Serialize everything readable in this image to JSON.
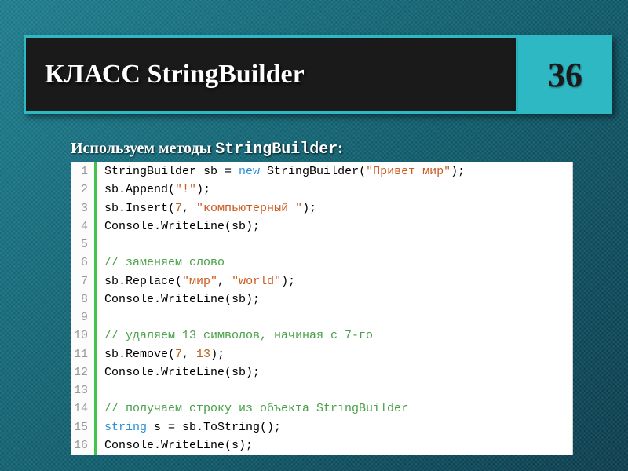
{
  "header": {
    "title": "КЛАСС StringBuilder",
    "page_number": "36"
  },
  "subtitle": {
    "prefix": "Используем методы ",
    "mono": "StringBuilder",
    "suffix": ":"
  },
  "code": {
    "lines": [
      {
        "n": "1",
        "segments": [
          {
            "t": "StringBuilder sb = "
          },
          {
            "t": "new",
            "c": "kw"
          },
          {
            "t": " StringBuilder("
          },
          {
            "t": "\"Привет мир\"",
            "c": "str"
          },
          {
            "t": ");"
          }
        ]
      },
      {
        "n": "2",
        "segments": [
          {
            "t": "sb.Append("
          },
          {
            "t": "\"!\"",
            "c": "str"
          },
          {
            "t": ");"
          }
        ]
      },
      {
        "n": "3",
        "segments": [
          {
            "t": "sb.Insert("
          },
          {
            "t": "7",
            "c": "num"
          },
          {
            "t": ", "
          },
          {
            "t": "\"компьютерный \"",
            "c": "str"
          },
          {
            "t": ");"
          }
        ]
      },
      {
        "n": "4",
        "segments": [
          {
            "t": "Console.WriteLine(sb);"
          }
        ]
      },
      {
        "n": "5",
        "segments": [
          {
            "t": ""
          }
        ]
      },
      {
        "n": "6",
        "segments": [
          {
            "t": "// заменяем слово",
            "c": "cmt"
          }
        ]
      },
      {
        "n": "7",
        "segments": [
          {
            "t": "sb.Replace("
          },
          {
            "t": "\"мир\"",
            "c": "str"
          },
          {
            "t": ", "
          },
          {
            "t": "\"world\"",
            "c": "str"
          },
          {
            "t": ");"
          }
        ]
      },
      {
        "n": "8",
        "segments": [
          {
            "t": "Console.WriteLine(sb);"
          }
        ]
      },
      {
        "n": "9",
        "segments": [
          {
            "t": ""
          }
        ]
      },
      {
        "n": "10",
        "segments": [
          {
            "t": "// удаляем 13 символов, начиная с 7-го",
            "c": "cmt"
          }
        ]
      },
      {
        "n": "11",
        "segments": [
          {
            "t": "sb.Remove("
          },
          {
            "t": "7",
            "c": "num"
          },
          {
            "t": ", "
          },
          {
            "t": "13",
            "c": "num"
          },
          {
            "t": ");"
          }
        ]
      },
      {
        "n": "12",
        "segments": [
          {
            "t": "Console.WriteLine(sb);"
          }
        ]
      },
      {
        "n": "13",
        "segments": [
          {
            "t": ""
          }
        ]
      },
      {
        "n": "14",
        "segments": [
          {
            "t": "// получаем строку из объекта StringBuilder",
            "c": "cmt"
          }
        ]
      },
      {
        "n": "15",
        "segments": [
          {
            "t": "string",
            "c": "kw"
          },
          {
            "t": " s = sb.ToString();"
          }
        ]
      },
      {
        "n": "16",
        "segments": [
          {
            "t": "Console.WriteLine(s);"
          }
        ]
      }
    ]
  }
}
